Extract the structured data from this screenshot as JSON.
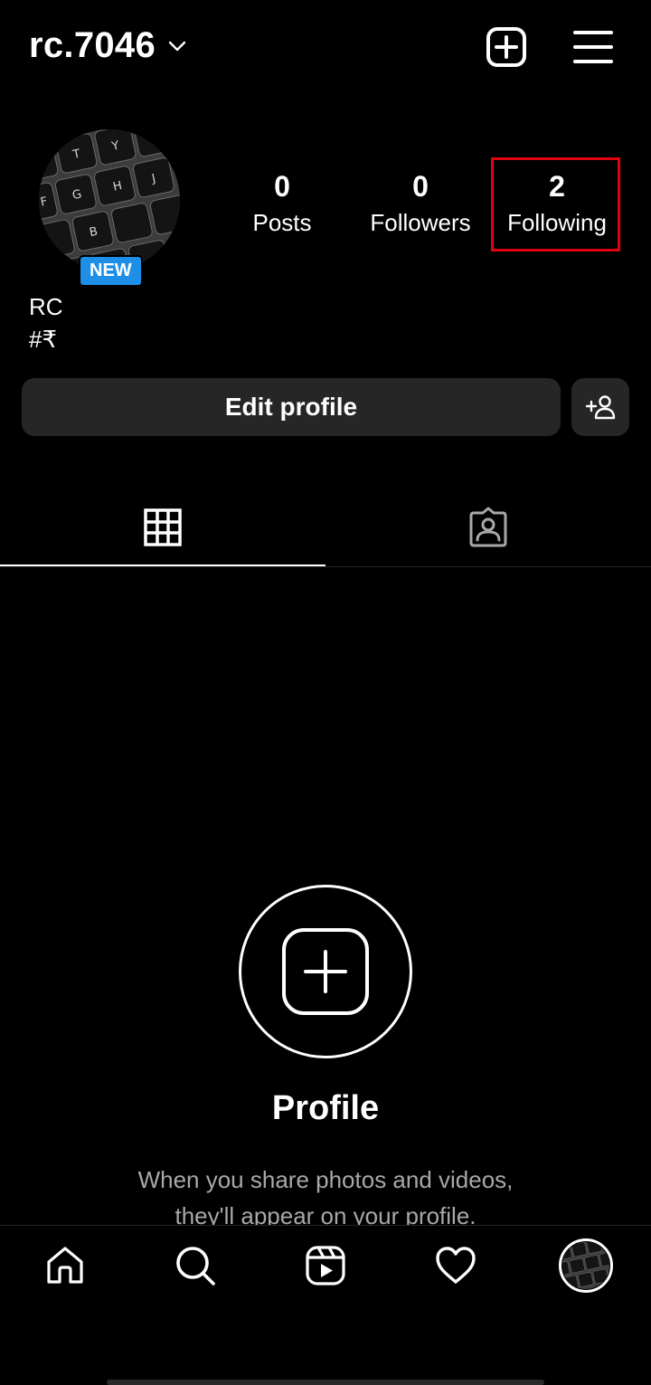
{
  "header": {
    "username": "rc.7046"
  },
  "profile": {
    "badge": "NEW",
    "name": "RC",
    "bio": "#₹",
    "stats": {
      "posts": {
        "count": "0",
        "label": "Posts"
      },
      "followers": {
        "count": "0",
        "label": "Followers"
      },
      "following": {
        "count": "2",
        "label": "Following"
      }
    },
    "edit_button": "Edit profile"
  },
  "empty_state": {
    "title": "Profile",
    "line1": "When you share photos and videos,",
    "line2": "they'll appear on your profile."
  },
  "icons": {
    "create": "plus-square-icon",
    "menu": "hamburger-menu-icon",
    "grid": "grid-icon",
    "tagged": "tagged-person-icon",
    "home": "home-icon",
    "search": "search-icon",
    "reels": "reels-icon",
    "activity": "heart-icon"
  },
  "colors": {
    "background": "#000000",
    "button": "#262626",
    "badge": "#1d8fe8",
    "highlight": "#e3000f",
    "muted_text": "#a8a8a8"
  }
}
